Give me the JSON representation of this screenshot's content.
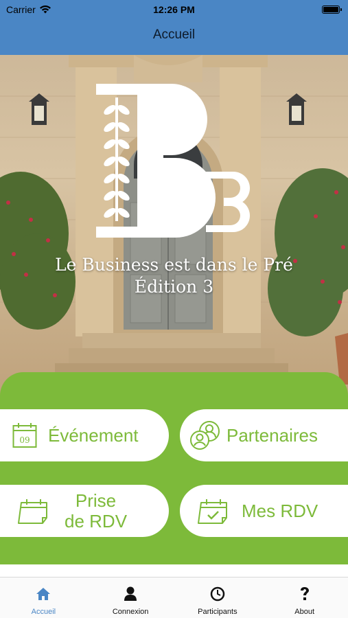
{
  "status_bar": {
    "carrier": "Carrier",
    "time": "12:26 PM"
  },
  "nav": {
    "title": "Accueil"
  },
  "hero": {
    "logo_text": "B3",
    "title_line1": "Le Business est dans le Pré",
    "title_line2": "Édition 3"
  },
  "tiles": {
    "evenement": {
      "label": "Événement",
      "calendar_day": "09",
      "icon": "calendar-icon"
    },
    "partenaires": {
      "label": "Partenaires",
      "icon": "partners-icon"
    },
    "prise_rdv": {
      "label_line1": "Prise",
      "label_line2": "de RDV",
      "icon": "calendar-blank-icon"
    },
    "mes_rdv": {
      "label": "Mes RDV",
      "icon": "calendar-check-icon"
    }
  },
  "tabbar": [
    {
      "label": "Accueil",
      "icon": "home-icon",
      "active": true
    },
    {
      "label": "Connexion",
      "icon": "user-icon",
      "active": false
    },
    {
      "label": "Participants",
      "icon": "clock-icon",
      "active": false
    },
    {
      "label": "About",
      "icon": "question-icon",
      "active": false
    }
  ],
  "colors": {
    "nav_blue": "#4a86c5",
    "green": "#7dba3a",
    "tab_active": "#4a86c5"
  }
}
